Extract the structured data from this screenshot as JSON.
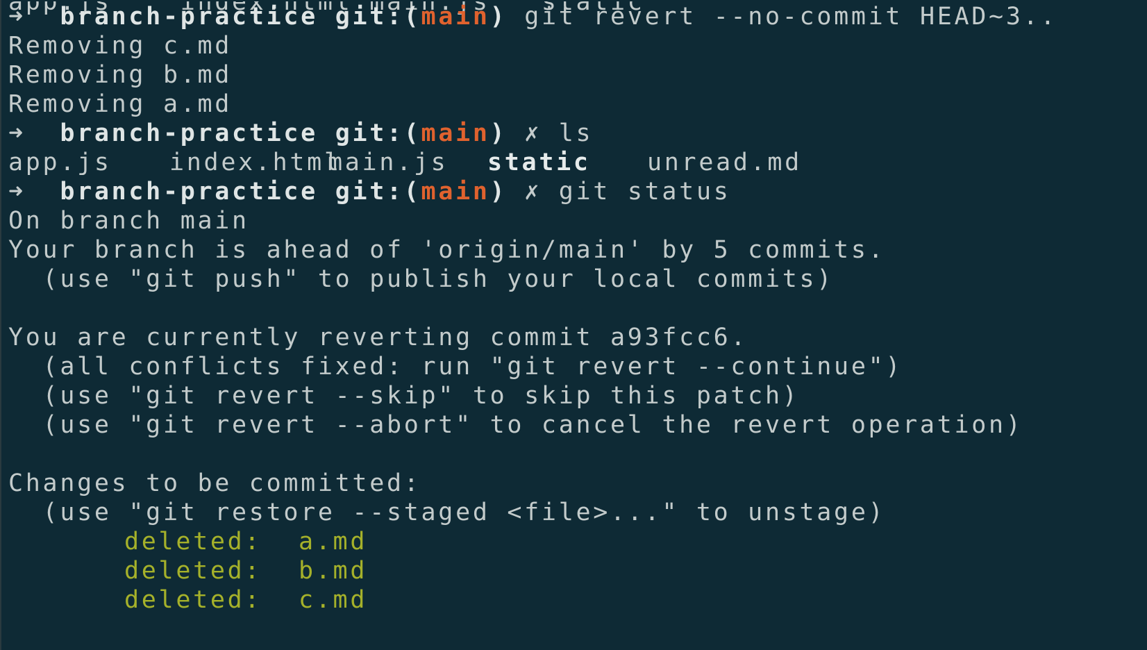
{
  "terminal": {
    "prompt": {
      "arrow": "➜",
      "directory": "branch-practice",
      "git_prefix": "git:(",
      "branch": "main",
      "git_suffix": ")",
      "dirty_mark": "✗"
    },
    "partial_top_line": "app.js    index.html main.js   static",
    "commands": [
      "git revert --no-commit HEAD~3..",
      "ls",
      "git status"
    ],
    "revert_output": [
      "Removing c.md",
      "Removing b.md",
      "Removing a.md"
    ],
    "ls_output": [
      "app.js",
      "index.html",
      "main.js",
      "static",
      "unread.md"
    ],
    "status_output": {
      "on_branch": "On branch main",
      "ahead": "Your branch is ahead of 'origin/main' by 5 commits.",
      "push_hint": "  (use \"git push\" to publish your local commits)",
      "reverting": "You are currently reverting commit a93fcc6.",
      "continue_hint": "  (all conflicts fixed: run \"git revert --continue\")",
      "skip_hint": "  (use \"git revert --skip\" to skip this patch)",
      "abort_hint": "  (use \"git revert --abort\" to cancel the revert operation)",
      "changes_header": "Changes to be committed:",
      "restore_hint": "  (use \"git restore --staged <file>...\" to unstage)",
      "deleted_label": "deleted:",
      "deleted_files": [
        "a.md",
        "b.md",
        "c.md"
      ]
    },
    "colors": {
      "background": "#0e2a35",
      "foreground": "#c3cbcb",
      "branch": "#e0622e",
      "deleted": "#a5b12a"
    }
  }
}
